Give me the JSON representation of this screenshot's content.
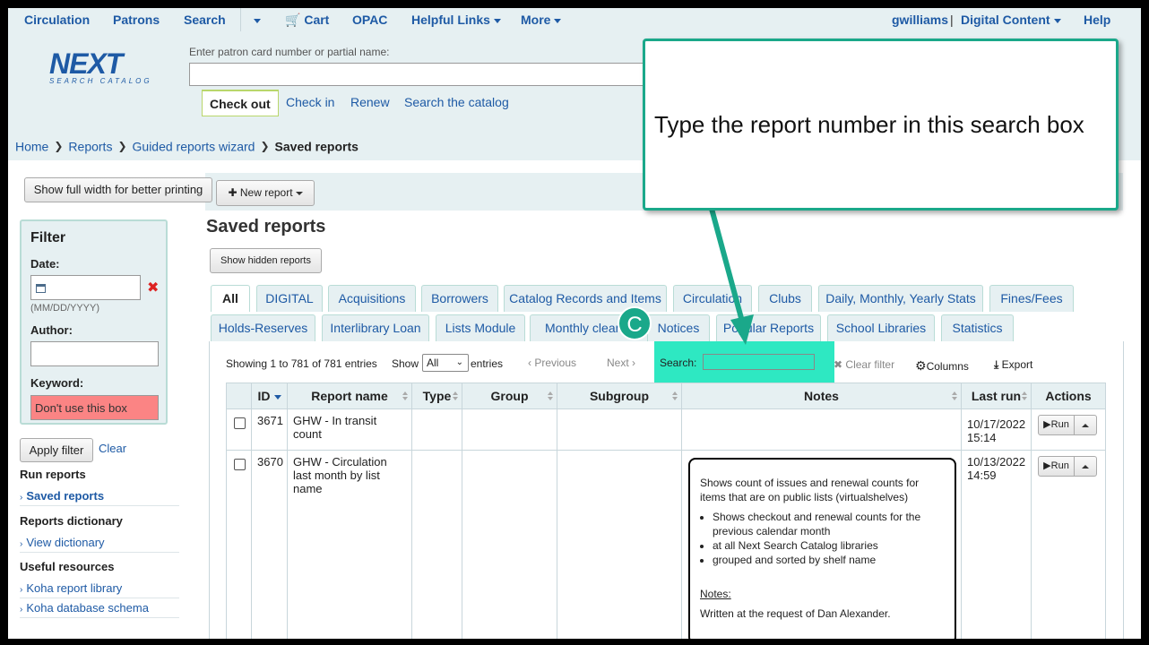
{
  "nav": {
    "circulation": "Circulation",
    "patrons": "Patrons",
    "search": "Search",
    "cart": "Cart",
    "opac": "OPAC",
    "helpful_links": "Helpful Links",
    "more": "More",
    "user": "gwilliams",
    "digital_content": "Digital Content",
    "help": "Help"
  },
  "header": {
    "logo_big": "NEXT",
    "logo_small": "SEARCH CATALOG",
    "patron_label": "Enter patron card number or partial name:",
    "tabs": [
      "Check out",
      "Check in",
      "Renew",
      "Search the catalog"
    ]
  },
  "breadcrumb": [
    "Home",
    "Reports",
    "Guided reports wizard",
    "Saved reports"
  ],
  "toolbar": {
    "full_width": "Show full width for better printing",
    "new_report": "New report"
  },
  "filter": {
    "title": "Filter",
    "date_label": "Date:",
    "date_hint": "(MM/DD/YYYY)",
    "author_label": "Author:",
    "keyword_label": "Keyword:",
    "keyword_value": "Don't use this box",
    "apply": "Apply filter",
    "clear": "Clear"
  },
  "sidebar": {
    "run_reports": "Run reports",
    "saved_reports": "Saved reports",
    "reports_dictionary": "Reports dictionary",
    "view_dictionary": "View dictionary",
    "useful_resources": "Useful resources",
    "koha_report_library": "Koha report library",
    "koha_db_schema": "Koha database schema"
  },
  "main": {
    "title": "Saved reports",
    "show_hidden": "Show hidden reports",
    "tabs_row1": [
      "All",
      "DIGITAL",
      "Acquisitions",
      "Borrowers",
      "Catalog Records and Items",
      "Circulation",
      "Clubs",
      "Daily, Monthly, Yearly Stats",
      "Fines/Fees"
    ],
    "tabs_row2": [
      "Holds-Reserves",
      "Interlibrary Loan",
      "Lists Module",
      "Monthly cleanup",
      "Notices",
      "Popular Reports",
      "School Libraries",
      "Statistics"
    ],
    "info": "Showing 1 to 781 of 781 entries",
    "show": "Show",
    "show_value": "All",
    "entries": "entries",
    "previous": "Previous",
    "next": "Next",
    "search_label": "Search:",
    "clear_filter": "Clear filter",
    "columns": "Columns",
    "export": "Export"
  },
  "table": {
    "headers": [
      "ID",
      "Report name",
      "Type",
      "Group",
      "Subgroup",
      "Notes",
      "Last run",
      "Actions"
    ],
    "rows": [
      {
        "id": "3671",
        "name": "GHW - In transit count",
        "last_run": "10/17/2022 15:14",
        "run": "Run"
      },
      {
        "id": "3670",
        "name": "GHW - Circulation last month by list name",
        "last_run": "10/13/2022 14:59",
        "run": "Run"
      }
    ],
    "notes": {
      "intro": "Shows count of issues and renewal counts for items that are on public lists (virtualshelves)",
      "bullets": [
        "Shows checkout and renewal counts for the previous calendar month",
        "at all Next Search Catalog libraries",
        "grouped and sorted by shelf name"
      ],
      "heading": "Notes:",
      "text": "Written at the request of Dan Alexander."
    }
  },
  "callout": {
    "text": "Type the report number in this search box",
    "badge": "C"
  },
  "colors": {
    "accent": "#1aa88a",
    "highlight": "#2ee8c2",
    "link": "#1e5aa5",
    "keyword_bg": "#fb8484"
  }
}
